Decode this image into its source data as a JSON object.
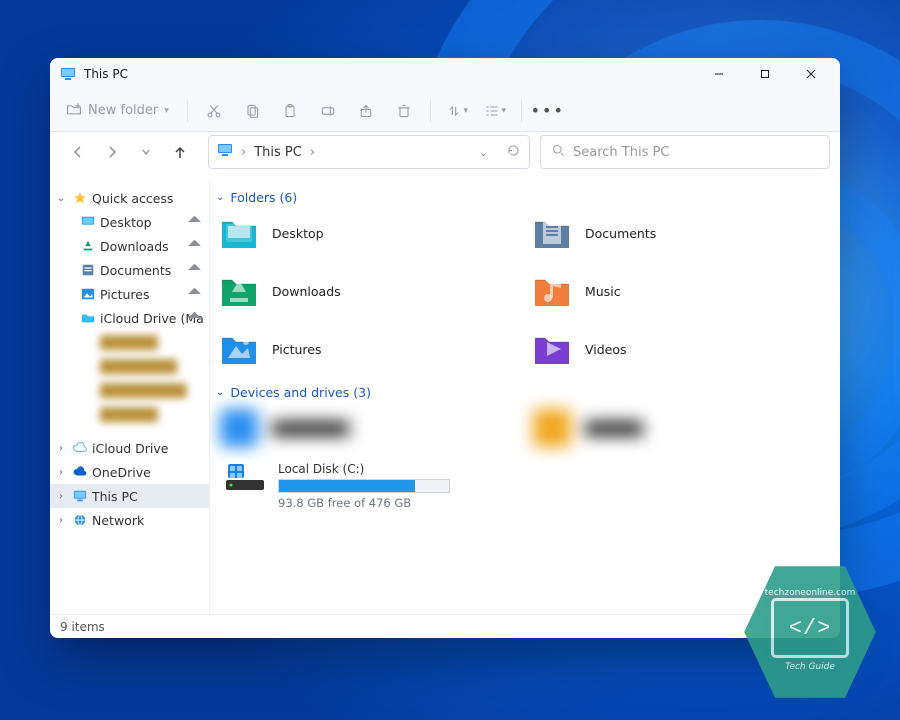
{
  "window": {
    "title": "This PC"
  },
  "toolbar": {
    "new_folder": "New folder"
  },
  "address": {
    "crumb1": "This PC"
  },
  "search": {
    "placeholder": "Search This PC"
  },
  "sidebar": {
    "quick_access": "Quick access",
    "items": [
      {
        "label": "Desktop"
      },
      {
        "label": "Downloads"
      },
      {
        "label": "Documents"
      },
      {
        "label": "Pictures"
      },
      {
        "label": "iCloud Drive (Ma"
      }
    ],
    "icloud": "iCloud Drive",
    "onedrive": "OneDrive",
    "this_pc": "This PC",
    "network": "Network"
  },
  "groups": {
    "folders": {
      "label": "Folders",
      "count": 6
    },
    "drives": {
      "label": "Devices and drives",
      "count": 3
    }
  },
  "folders": [
    {
      "name": "Desktop",
      "color": "#17b7d4",
      "glyph": "desktop"
    },
    {
      "name": "Documents",
      "color": "#5e7ea3",
      "glyph": "doc"
    },
    {
      "name": "Downloads",
      "color": "#11a36c",
      "glyph": "down"
    },
    {
      "name": "Music",
      "color": "#f07e3c",
      "glyph": "music"
    },
    {
      "name": "Pictures",
      "color": "#1f8fe8",
      "glyph": "pic"
    },
    {
      "name": "Videos",
      "color": "#7a3fd0",
      "glyph": "vid"
    }
  ],
  "disk": {
    "name": "Local Disk (C:)",
    "free_text": "93.8 GB free of 476 GB",
    "used_pct": 80
  },
  "status": {
    "text": "9 items"
  },
  "watermark": {
    "line1": "techzoneonline.com",
    "line2": "Tech Guide"
  }
}
